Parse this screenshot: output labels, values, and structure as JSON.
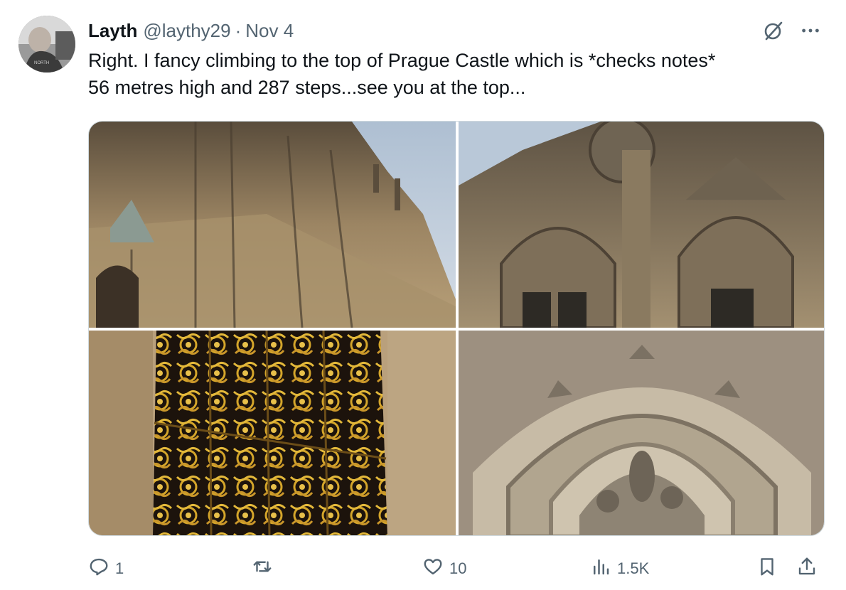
{
  "tweet": {
    "author_name": "Layth",
    "handle": "@laythy29",
    "separator": "·",
    "date": "Nov 4",
    "text_line1": "Right. I fancy climbing to the top of Prague Castle which is *checks notes*",
    "text_line2": "56 metres high and 287 steps...see you at the top..."
  },
  "icons": {
    "avatar": "avatar-photo",
    "grok": "grok-icon",
    "more": "more-icon",
    "reply": "reply-icon",
    "repost": "repost-icon",
    "like": "like-icon",
    "views": "views-icon",
    "bookmark": "bookmark-icon",
    "share": "share-icon"
  },
  "media": [
    {
      "name": "photo-cathedral-tower"
    },
    {
      "name": "photo-cathedral-facade"
    },
    {
      "name": "photo-golden-lattice"
    },
    {
      "name": "photo-portal-arch"
    }
  ],
  "actions": {
    "reply_count": "1",
    "repost_count": "",
    "like_count": "10",
    "views_count": "1.5K"
  },
  "colors": {
    "text": "#0f1419",
    "muted": "#536471",
    "border": "#cfd9de"
  }
}
